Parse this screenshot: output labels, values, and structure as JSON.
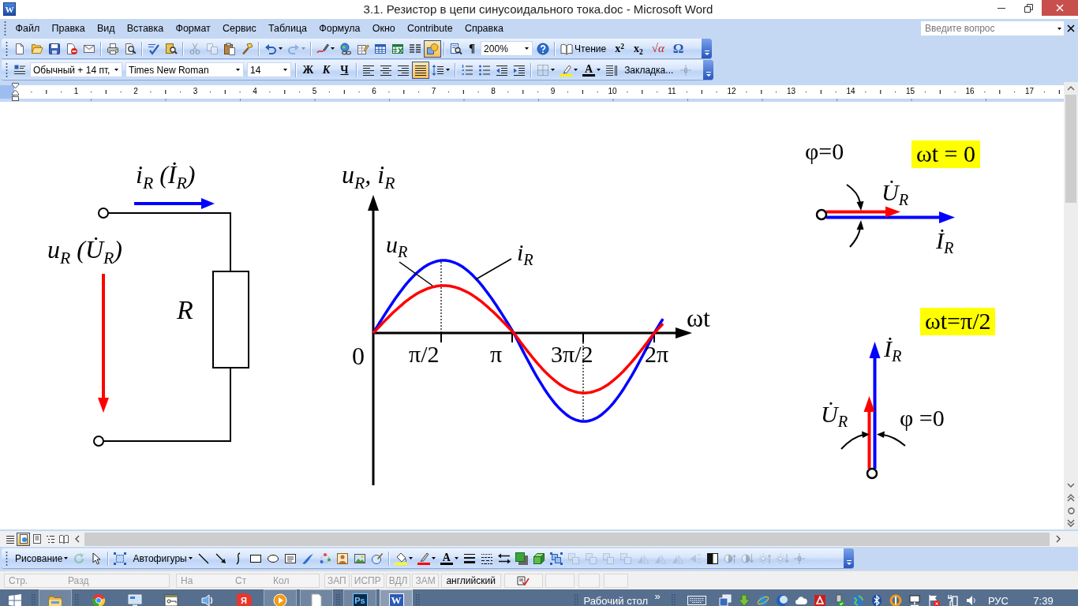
{
  "window": {
    "title": "3.1. Резистор в цепи синусоидального тока.doc - Microsoft Word",
    "app_glyph": "W"
  },
  "menu_bar": {
    "items": [
      "Файл",
      "Правка",
      "Вид",
      "Вставка",
      "Формат",
      "Сервис",
      "Таблица",
      "Формула",
      "Окно",
      "Contribute",
      "Справка"
    ],
    "help_search": {
      "placeholder": "Введите вопрос"
    }
  },
  "standard_toolbar": {
    "groups": [
      [
        {
          "kind": "new",
          "pressed": false,
          "disabled": false
        },
        {
          "kind": "open",
          "pressed": false,
          "disabled": false
        },
        {
          "kind": "save",
          "pressed": false,
          "disabled": false
        },
        {
          "kind": "permission",
          "pressed": false,
          "disabled": false
        },
        {
          "kind": "email",
          "pressed": false,
          "disabled": false
        }
      ],
      [
        {
          "kind": "print",
          "pressed": false,
          "disabled": false
        },
        {
          "kind": "preview",
          "pressed": false,
          "disabled": false
        }
      ],
      [
        {
          "kind": "spelling",
          "pressed": false,
          "disabled": false
        },
        {
          "kind": "research",
          "pressed": false,
          "disabled": false
        }
      ],
      [
        {
          "kind": "cut",
          "pressed": false,
          "disabled": true
        },
        {
          "kind": "copy",
          "pressed": false,
          "disabled": true
        },
        {
          "kind": "paste",
          "pressed": false,
          "disabled": false
        },
        {
          "kind": "painter",
          "pressed": false,
          "disabled": false
        }
      ],
      [
        {
          "kind": "undo",
          "pressed": false,
          "disabled": false
        },
        {
          "kind": "redo",
          "pressed": false,
          "disabled": true
        }
      ],
      [
        {
          "kind": "ink",
          "pressed": false,
          "disabled": false
        },
        {
          "kind": "hyperlink",
          "pressed": false,
          "disabled": false
        },
        {
          "kind": "tablesborders",
          "pressed": false,
          "disabled": false
        },
        {
          "kind": "table",
          "pressed": false,
          "disabled": false
        },
        {
          "kind": "spreadsheet",
          "pressed": false,
          "disabled": false
        },
        {
          "kind": "columns",
          "pressed": false,
          "disabled": false
        },
        {
          "kind": "drawing",
          "pressed": true,
          "disabled": false
        }
      ],
      [
        {
          "kind": "docmap",
          "pressed": false,
          "disabled": false
        },
        {
          "kind": "pilcrow",
          "label": "¶",
          "pressed": false,
          "disabled": false
        },
        {
          "kind": "zoombox",
          "value": "200%"
        },
        {
          "kind": "help",
          "pressed": false,
          "disabled": false
        }
      ],
      [
        {
          "kind": "reading",
          "label": "Чтение",
          "pressed": false,
          "disabled": false
        },
        {
          "kind": "superscript",
          "label": "x$^{2}$",
          "pressed": false,
          "disabled": false
        },
        {
          "kind": "subscript",
          "label": "x$_{2}$",
          "pressed": false,
          "disabled": false
        },
        {
          "kind": "equation",
          "label": "√α",
          "pressed": false,
          "disabled": false
        },
        {
          "kind": "symbol",
          "label": "Ω",
          "pressed": false,
          "disabled": false
        }
      ]
    ]
  },
  "formatting_toolbar": {
    "groups": [
      [
        {
          "kind": "styles",
          "pressed": false,
          "disabled": false
        },
        {
          "kind": "stylebox",
          "value": "Обычный + 14 пт,"
        },
        {
          "kind": "fontbox",
          "value": "Times New Roman"
        },
        {
          "kind": "sizebox",
          "value": "14"
        }
      ],
      [
        {
          "kind": "bold",
          "label": "Ж",
          "pressed": false,
          "disabled": false
        },
        {
          "kind": "italic",
          "label": "К",
          "pressed": false,
          "disabled": false
        },
        {
          "kind": "underline",
          "label": "Ч",
          "pressed": false,
          "disabled": false
        }
      ],
      [
        {
          "kind": "alignleft",
          "pressed": false,
          "disabled": false
        },
        {
          "kind": "aligncenter",
          "pressed": false,
          "disabled": false
        },
        {
          "kind": "alignright",
          "pressed": false,
          "disabled": false
        },
        {
          "kind": "justify",
          "pressed": true,
          "disabled": false
        },
        {
          "kind": "linespacing",
          "pressed": false,
          "disabled": false
        }
      ],
      [
        {
          "kind": "numbering",
          "pressed": false,
          "disabled": false
        },
        {
          "kind": "bullets",
          "pressed": false,
          "disabled": false
        },
        {
          "kind": "outdent",
          "pressed": false,
          "disabled": false
        },
        {
          "kind": "indent",
          "pressed": false,
          "disabled": false
        }
      ],
      [
        {
          "kind": "border",
          "pressed": false,
          "disabled": false
        },
        {
          "kind": "highlight",
          "pressed": false,
          "disabled": false
        },
        {
          "kind": "fontcolor",
          "label": "A",
          "pressed": false,
          "disabled": false
        },
        {
          "kind": "textlines",
          "pressed": false,
          "disabled": false
        },
        {
          "kind": "bookmark",
          "label": "Закладка...",
          "pressed": false,
          "disabled": false
        },
        {
          "kind": "crosshair",
          "pressed": false,
          "disabled": true
        }
      ]
    ]
  },
  "ruler": {
    "labels": [
      "1",
      "2",
      "3",
      "4",
      "5",
      "6",
      "7",
      "8",
      "9",
      "10",
      "11",
      "12",
      "13",
      "14",
      "15",
      "16",
      "17"
    ]
  },
  "document": {
    "circuit": {
      "current_label": "i$_{R}$ (İ$_{R}$)",
      "voltage_label": "u$_{R}$ (U̇$_{R}$)",
      "resistor_label": "R"
    },
    "waveforms": {
      "vertical_axis_label": "u$_{R}$, i$_{R}$",
      "horizontal_axis_label": "ωt",
      "origin_label": "0",
      "tick_labels": [
        "π/2",
        "π",
        "3π/2",
        "2π"
      ],
      "curve_labels": [
        "u$_{R}$",
        "i$_{R}$"
      ]
    },
    "phasor_diagrams": [
      {
        "title": "ωt = 0",
        "angle_label": "φ=0",
        "voltage_label": "U̇$_{R}$",
        "current_label": "İ$_{R}$"
      },
      {
        "title": "ωt=π/2",
        "angle_label": "φ =0",
        "voltage_label": "U̇$_{R}$",
        "current_label": "İ$_{R}$"
      }
    ]
  },
  "view_buttons": [
    {
      "kind": "normal",
      "selected": false
    },
    {
      "kind": "web",
      "selected": true
    },
    {
      "kind": "print",
      "selected": false
    },
    {
      "kind": "outline",
      "selected": false
    },
    {
      "kind": "reading",
      "selected": false
    }
  ],
  "drawing_toolbar": {
    "groups": [
      [
        {
          "kind": "drawmenu",
          "label": "Рисование",
          "pressed": false,
          "disabled": false
        },
        {
          "kind": "rotate",
          "pressed": false,
          "disabled": true
        },
        {
          "kind": "pointer",
          "pressed": false,
          "disabled": false
        }
      ],
      [
        {
          "kind": "selectobjects",
          "pressed": false,
          "disabled": false
        },
        {
          "kind": "shapesmenu",
          "label": "Автофигуры",
          "pressed": false,
          "disabled": false
        },
        {
          "kind": "line",
          "pressed": false,
          "disabled": false
        },
        {
          "kind": "arrow",
          "pressed": false,
          "disabled": false
        },
        {
          "kind": "curve",
          "pressed": false,
          "disabled": false
        },
        {
          "kind": "rectangle",
          "pressed": false,
          "disabled": false
        },
        {
          "kind": "oval",
          "pressed": false,
          "disabled": false
        },
        {
          "kind": "textbox",
          "pressed": false,
          "disabled": false
        },
        {
          "kind": "wordart",
          "pressed": false,
          "disabled": false
        },
        {
          "kind": "diagram",
          "pressed": false,
          "disabled": false
        },
        {
          "kind": "clipart",
          "pressed": false,
          "disabled": false
        },
        {
          "kind": "picture",
          "pressed": false,
          "disabled": false
        },
        {
          "kind": "inkbrush",
          "pressed": false,
          "disabled": false
        }
      ],
      [
        {
          "kind": "fillcolor",
          "pressed": false,
          "disabled": false
        },
        {
          "kind": "linecolor",
          "pressed": false,
          "disabled": false
        },
        {
          "kind": "fontcolor",
          "label": "A",
          "pressed": false,
          "disabled": false
        },
        {
          "kind": "linestyle",
          "pressed": false,
          "disabled": false
        },
        {
          "kind": "dashstyle",
          "pressed": false,
          "disabled": false
        },
        {
          "kind": "arrowstyle",
          "pressed": false,
          "disabled": false
        },
        {
          "kind": "shadow",
          "pressed": false,
          "disabled": false
        },
        {
          "kind": "threed",
          "pressed": false,
          "disabled": false
        },
        {
          "kind": "group",
          "pressed": false,
          "disabled": false
        },
        {
          "kind": "order",
          "pressed": false,
          "disabled": true
        },
        {
          "kind": "order",
          "pressed": false,
          "disabled": true
        },
        {
          "kind": "order",
          "pressed": false,
          "disabled": true
        },
        {
          "kind": "order",
          "pressed": false,
          "disabled": true
        },
        {
          "kind": "flip",
          "pressed": false,
          "disabled": true
        },
        {
          "kind": "flip",
          "pressed": false,
          "disabled": true
        },
        {
          "kind": "flip",
          "pressed": false,
          "disabled": true
        },
        {
          "kind": "aligntri",
          "pressed": false,
          "disabled": true
        },
        {
          "kind": "contrast",
          "pressed": false,
          "disabled": false
        },
        {
          "kind": "morecontrast",
          "pressed": false,
          "disabled": true
        },
        {
          "kind": "lesscontrast",
          "pressed": false,
          "disabled": true
        },
        {
          "kind": "morebright",
          "pressed": false,
          "disabled": true
        },
        {
          "kind": "lessbright",
          "pressed": false,
          "disabled": true
        },
        {
          "kind": "crosshair",
          "pressed": false,
          "disabled": true
        }
      ]
    ]
  },
  "status_bar": {
    "position": [
      "Стр.",
      "Разд"
    ],
    "cursor": [
      "На",
      "Ст",
      "Кол"
    ],
    "modes": [
      {
        "label": "ЗАП",
        "on": false
      },
      {
        "label": "ИСПР",
        "on": false
      },
      {
        "label": "ВДЛ",
        "on": false
      },
      {
        "label": "ЗАМ",
        "on": false
      }
    ],
    "language": "английский"
  },
  "taskbar": {
    "app_groups": [
      [
        {
          "kind": "explorer",
          "running": true,
          "selected": false
        }
      ],
      [
        {
          "kind": "browser",
          "running": false,
          "selected": false
        },
        {
          "kind": "monitor",
          "running": false,
          "selected": false
        },
        {
          "kind": "viewer",
          "running": false,
          "selected": false
        },
        {
          "kind": "audio",
          "running": false,
          "selected": false
        },
        {
          "kind": "yandex",
          "glyph": "Я",
          "running": false,
          "selected": false
        },
        {
          "kind": "media",
          "running": true,
          "selected": false
        },
        {
          "kind": "notepad",
          "running": true,
          "selected": false
        }
      ],
      [
        {
          "kind": "photoshop",
          "glyph": "Ps",
          "running": true,
          "selected": false
        },
        {
          "kind": "word",
          "glyph": "W",
          "running": true,
          "selected": true
        }
      ]
    ],
    "desktop_toolbar": {
      "label": "Рабочий стол",
      "chevron": "»"
    },
    "language": "РУС",
    "clock": "7:39"
  }
}
